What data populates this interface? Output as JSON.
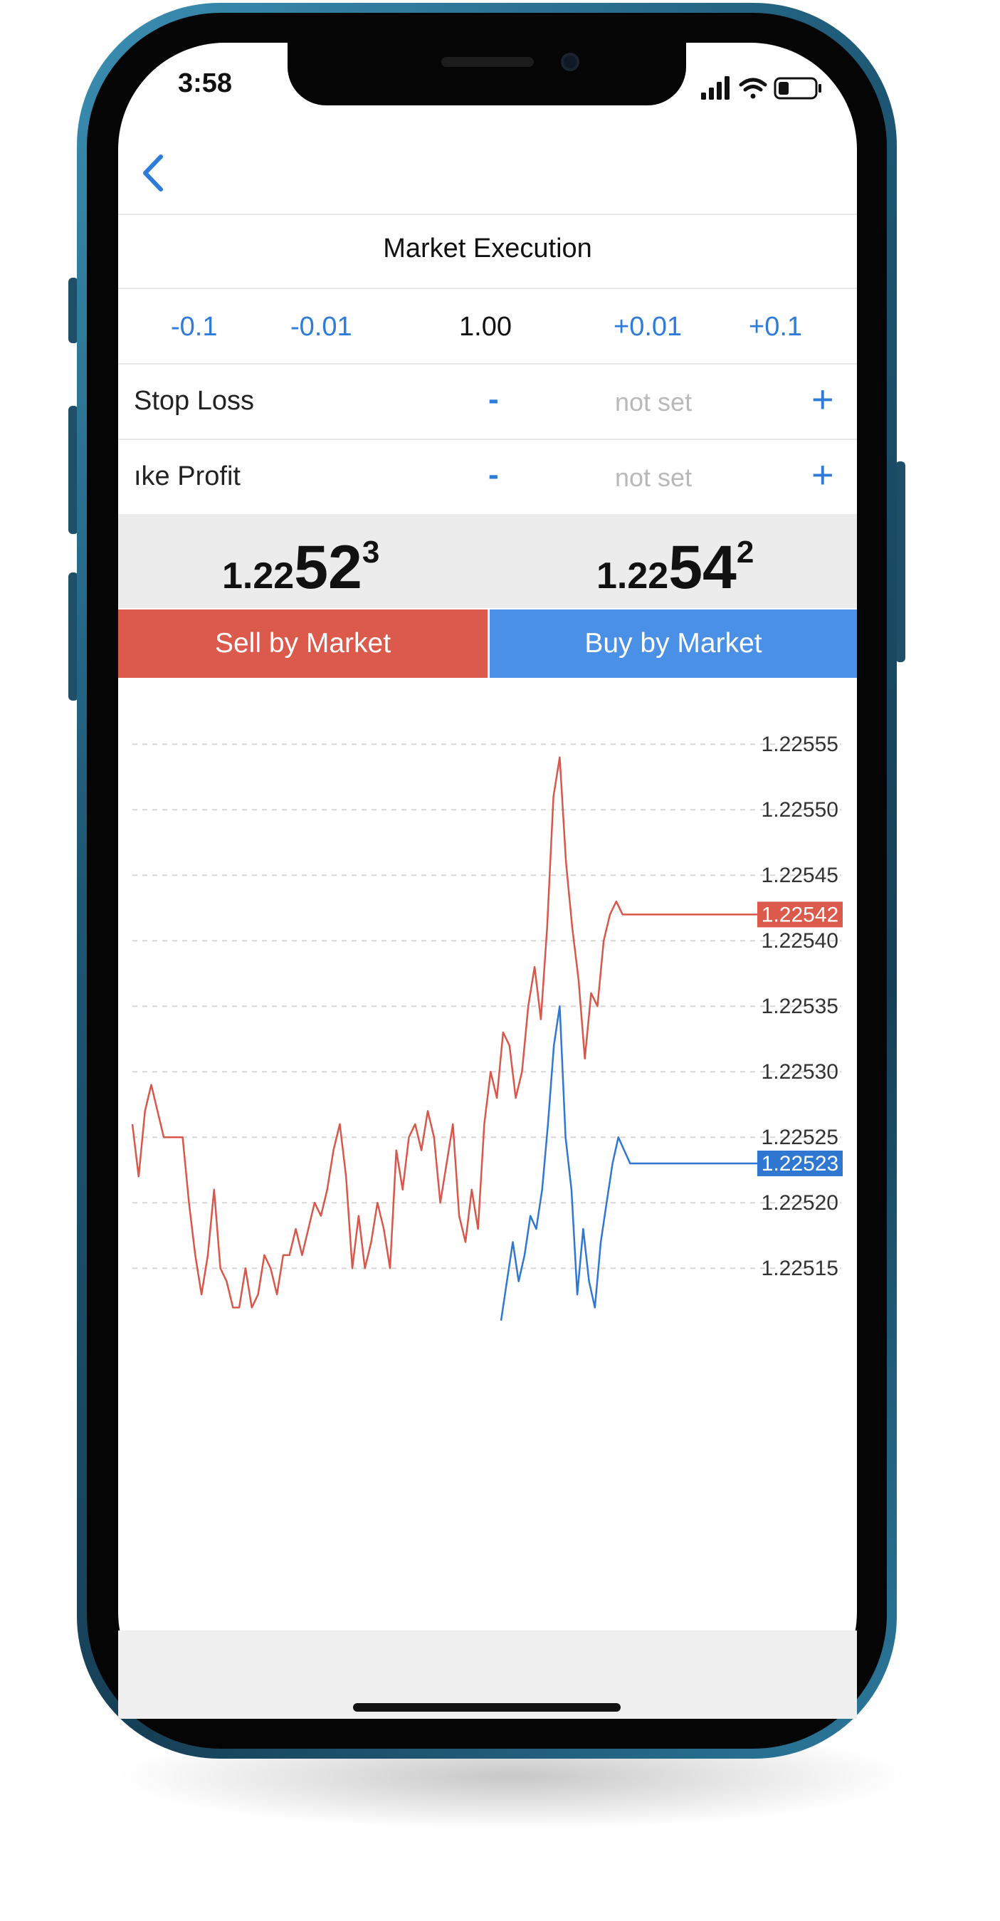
{
  "status_bar": {
    "time": "3:58",
    "icons": [
      "signal-icon",
      "wifi-icon",
      "battery-icon"
    ]
  },
  "nav": {
    "back_icon": "chevron-left-icon"
  },
  "order": {
    "title": "Market Execution",
    "volume": {
      "decrement_large": "-0.1",
      "decrement_small": "-0.01",
      "value": "1.00",
      "increment_small": "+0.01",
      "increment_large": "+0.1"
    },
    "stop_loss": {
      "label": "Stop Loss",
      "minus": "-",
      "value": "not set",
      "plus": "+"
    },
    "take_profit": {
      "label": "ıke Profit",
      "minus": "-",
      "value": "not set",
      "plus": "+"
    }
  },
  "quotes": {
    "bid": {
      "prefix": "1.22",
      "big": "52",
      "sup": "3"
    },
    "ask": {
      "prefix": "1.22",
      "big": "54",
      "sup": "2"
    }
  },
  "actions": {
    "sell_label": "Sell by Market",
    "buy_label": "Buy by Market"
  },
  "colors": {
    "accent_blue": "#2f7bd9",
    "sell_red": "#db5a4c",
    "buy_blue": "#4a90e6",
    "bid_line": "#d9574a",
    "ask_line": "#2f77d0"
  },
  "chart_data": {
    "type": "line",
    "ylim": [
      1.22508,
      1.22558
    ],
    "yticks": [
      "1.22555",
      "1.22550",
      "1.22545",
      "1.22540",
      "1.22535",
      "1.22530",
      "1.22525",
      "1.22520",
      "1.22515"
    ],
    "grid": true,
    "series": [
      {
        "role": "upper",
        "values": [
          1.22526,
          1.22522,
          1.22527,
          1.22529,
          1.22527,
          1.22525,
          1.22525,
          1.22525,
          1.22525,
          1.2252,
          1.22516,
          1.22513,
          1.22516,
          1.22521,
          1.22515,
          1.22514,
          1.22512,
          1.22512,
          1.22515,
          1.22512,
          1.22513,
          1.22516,
          1.22515,
          1.22513,
          1.22516,
          1.22516,
          1.22518,
          1.22516,
          1.22518,
          1.2252,
          1.22519,
          1.22521,
          1.22524,
          1.22526,
          1.22522,
          1.22515,
          1.22519,
          1.22515,
          1.22517,
          1.2252,
          1.22518,
          1.22515,
          1.22524,
          1.22521,
          1.22525,
          1.22526,
          1.22524,
          1.22527,
          1.22525,
          1.2252,
          1.22523,
          1.22526,
          1.22519,
          1.22517,
          1.22521,
          1.22518,
          1.22526,
          1.2253,
          1.22528,
          1.22533,
          1.22532,
          1.22528,
          1.2253,
          1.22535,
          1.22538,
          1.22534,
          1.22541,
          1.22551,
          1.22554,
          1.22546,
          1.22541,
          1.22537,
          1.22531,
          1.22536,
          1.22535,
          1.2254,
          1.22542,
          1.22543,
          1.22542,
          1.22542,
          1.22542,
          1.22542,
          1.22542
        ]
      },
      {
        "role": "lower",
        "values": [
          1.22511,
          1.22514,
          1.22517,
          1.22514,
          1.22516,
          1.22519,
          1.22518,
          1.22521,
          1.22526,
          1.22532,
          1.22535,
          1.22525,
          1.22521,
          1.22513,
          1.22518,
          1.22514,
          1.22512,
          1.22517,
          1.2252,
          1.22523,
          1.22525,
          1.22524,
          1.22523,
          1.22523,
          1.22523,
          1.22523
        ]
      }
    ],
    "markers": [
      {
        "label": "1.22542",
        "value": 1.22542,
        "color": "#db5a4c"
      },
      {
        "label": "1.22523",
        "value": 1.22523,
        "color": "#2f77d0"
      }
    ]
  }
}
